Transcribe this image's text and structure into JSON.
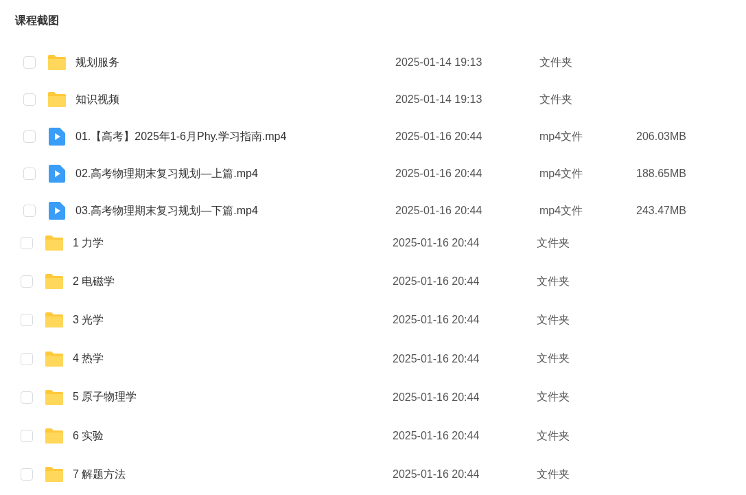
{
  "title": "课程截图",
  "groups": [
    {
      "rows": [
        {
          "kind": "folder",
          "checked": false,
          "name": "规划服务",
          "date": "2025-01-14 19:13",
          "type": "文件夹"
        },
        {
          "kind": "folder",
          "checked": false,
          "name": "知识视频",
          "date": "2025-01-14 19:13",
          "type": "文件夹"
        },
        {
          "kind": "video",
          "checked": false,
          "name": "01.【高考】2025年1-6月Phy.学习指南.mp4",
          "date": "2025-01-16 20:44",
          "type": "mp4文件",
          "size": "206.03MB"
        },
        {
          "kind": "video",
          "checked": false,
          "name": "02.高考物理期末复习规划—上篇.mp4",
          "date": "2025-01-16 20:44",
          "type": "mp4文件",
          "size": "188.65MB"
        },
        {
          "kind": "video",
          "checked": false,
          "name": "03.高考物理期末复习规划—下篇.mp4",
          "date": "2025-01-16 20:44",
          "type": "mp4文件",
          "size": "243.47MB"
        }
      ]
    },
    {
      "rows": [
        {
          "kind": "folder",
          "checked": false,
          "name": "1 力学",
          "date": "2025-01-16 20:44",
          "type": "文件夹"
        },
        {
          "kind": "folder",
          "checked": false,
          "name": "2 电磁学",
          "date": "2025-01-16 20:44",
          "type": "文件夹"
        },
        {
          "kind": "folder",
          "checked": false,
          "name": "3 光学",
          "date": "2025-01-16 20:44",
          "type": "文件夹"
        },
        {
          "kind": "folder",
          "checked": false,
          "name": "4 热学",
          "date": "2025-01-16 20:44",
          "type": "文件夹"
        },
        {
          "kind": "folder",
          "checked": false,
          "name": "5 原子物理学",
          "date": "2025-01-16 20:44",
          "type": "文件夹"
        },
        {
          "kind": "folder",
          "checked": false,
          "name": "6 实验",
          "date": "2025-01-16 20:44",
          "type": "文件夹"
        },
        {
          "kind": "folder",
          "checked": false,
          "name": "7 解题方法",
          "date": "2025-01-16 20:44",
          "type": "文件夹"
        }
      ]
    }
  ]
}
